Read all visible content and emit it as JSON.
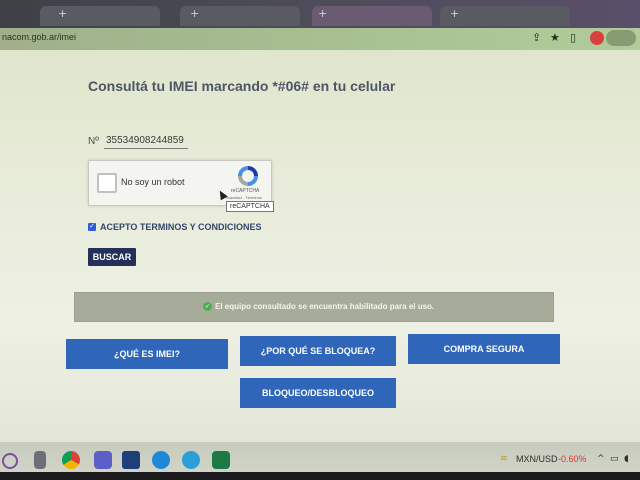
{
  "browser": {
    "url": "nacom.gob.ar/imei",
    "tab_icons": [
      "plus-icon",
      "plus-icon",
      "plus-icon",
      "plus-icon"
    ],
    "addr_icons": [
      "share-icon",
      "star-icon",
      "extension-icon"
    ]
  },
  "page": {
    "title": "Consultá tu IMEI marcando *#06# en tu celular",
    "imei_label": "Nº",
    "imei_value": "35534908244859",
    "captcha": {
      "label": "No soy un robot",
      "brand": "reCAPTCHA",
      "links": "Privacidad - Términos",
      "tooltip": "reCAPTCHA"
    },
    "terms_checked": true,
    "terms_label": "ACEPTO TERMINOS Y CONDICIONES",
    "search_button": "BUSCAR",
    "status_message": "El equipo consultado se encuentra habilitado para el uso.",
    "nav_buttons": {
      "what_is_imei": "¿QUÉ ES IMEI?",
      "why_blocked": "¿POR QUÉ SE BLOQUEA?",
      "safe_purchase": "COMPRA SEGURA",
      "block_unblock": "BLOQUEO/DESBLOQUEO"
    }
  },
  "taskbar": {
    "currency_pair": "MXN/USD",
    "currency_change": "-0.60%",
    "currency_change_color": "#d33b2c",
    "icons": [
      "search-circle-icon",
      "calculator-icon",
      "chrome-icon",
      "teams-icon",
      "clock-icon",
      "edge-icon",
      "edge-icon",
      "excel-icon"
    ]
  },
  "colors": {
    "nav_button": "#2f66b9",
    "search_button": "#24305a",
    "status_bar": "#a6ac99"
  }
}
